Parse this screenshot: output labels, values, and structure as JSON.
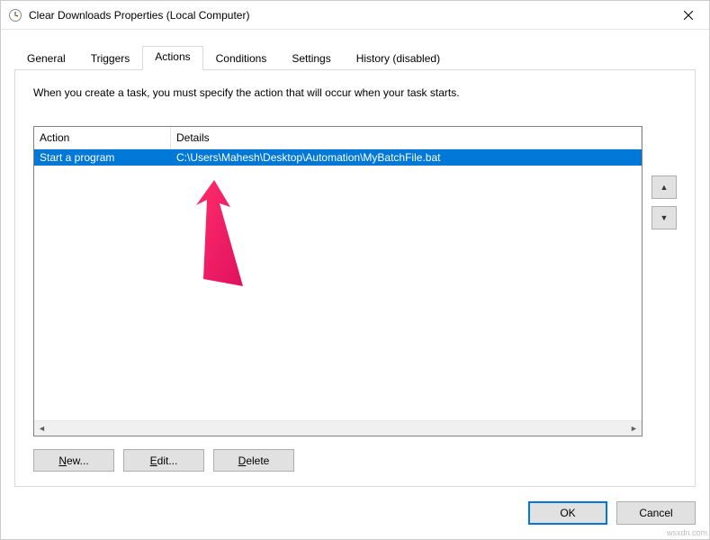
{
  "window": {
    "title": "Clear Downloads Properties (Local Computer)"
  },
  "tabs": {
    "items": [
      {
        "label": "General"
      },
      {
        "label": "Triggers"
      },
      {
        "label": "Actions"
      },
      {
        "label": "Conditions"
      },
      {
        "label": "Settings"
      },
      {
        "label": "History (disabled)"
      }
    ]
  },
  "panel": {
    "instruction": "When you create a task, you must specify the action that will occur when your task starts.",
    "columns": {
      "action": "Action",
      "details": "Details"
    },
    "rows": [
      {
        "action": "Start a program",
        "details": "C:\\Users\\Mahesh\\Desktop\\Automation\\MyBatchFile.bat"
      }
    ],
    "buttons": {
      "new": "New...",
      "edit": "Edit...",
      "delete": "Delete"
    },
    "move": {
      "up": "▲",
      "down": "▼"
    }
  },
  "dialog": {
    "ok": "OK",
    "cancel": "Cancel"
  },
  "watermark": "wsxdn.com"
}
